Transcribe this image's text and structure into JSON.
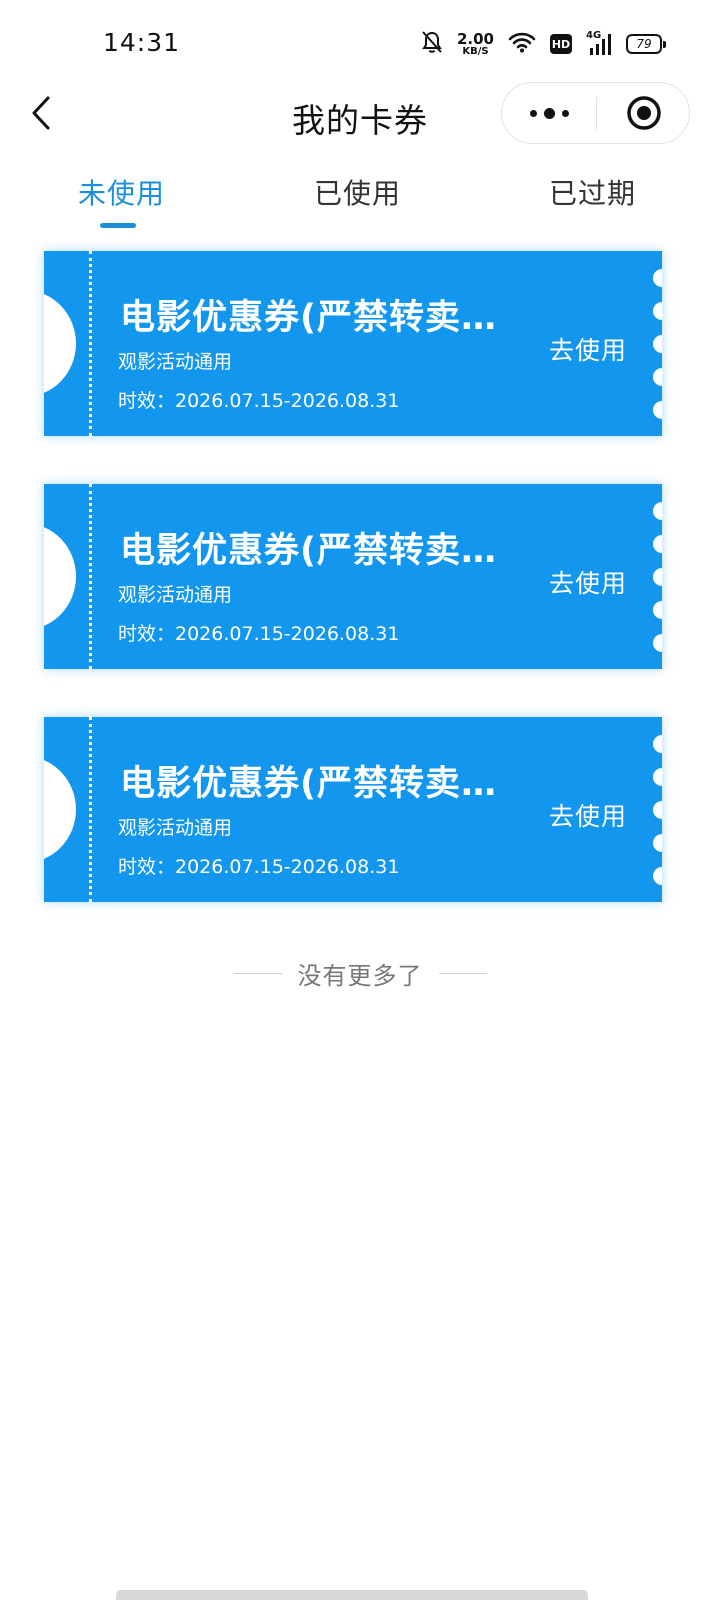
{
  "status_bar": {
    "time": "14:31",
    "net_speed_value": "2.00",
    "net_speed_unit": "KB/S",
    "hd_label": "HD",
    "signal_label": "4G",
    "battery_level": "79",
    "icons": [
      "bell-mute-icon",
      "wifi-icon",
      "hd-icon",
      "signal-icon",
      "battery-icon"
    ]
  },
  "nav": {
    "title": "我的卡券",
    "back_icon": "chevron-left-icon",
    "more_icon": "more-dots-icon",
    "close_icon": "target-circle-icon"
  },
  "tabs": [
    {
      "label": "未使用",
      "active": true
    },
    {
      "label": "已使用",
      "active": false
    },
    {
      "label": "已过期",
      "active": false
    }
  ],
  "coupons": [
    {
      "title": "电影优惠券(严禁转卖…",
      "subtitle": "观影活动通用",
      "validity": "时效：2026.07.15-2026.08.31",
      "action": "去使用"
    },
    {
      "title": "电影优惠券(严禁转卖…",
      "subtitle": "观影活动通用",
      "validity": "时效：2026.07.15-2026.08.31",
      "action": "去使用"
    },
    {
      "title": "电影优惠券(严禁转卖…",
      "subtitle": "观影活动通用",
      "validity": "时效：2026.07.15-2026.08.31",
      "action": "去使用"
    }
  ],
  "end_of_list": "没有更多了",
  "colors": {
    "accent": "#1a8fdc",
    "coupon_bg": "#1296ee",
    "text_primary": "#111111",
    "text_muted": "#777777"
  }
}
